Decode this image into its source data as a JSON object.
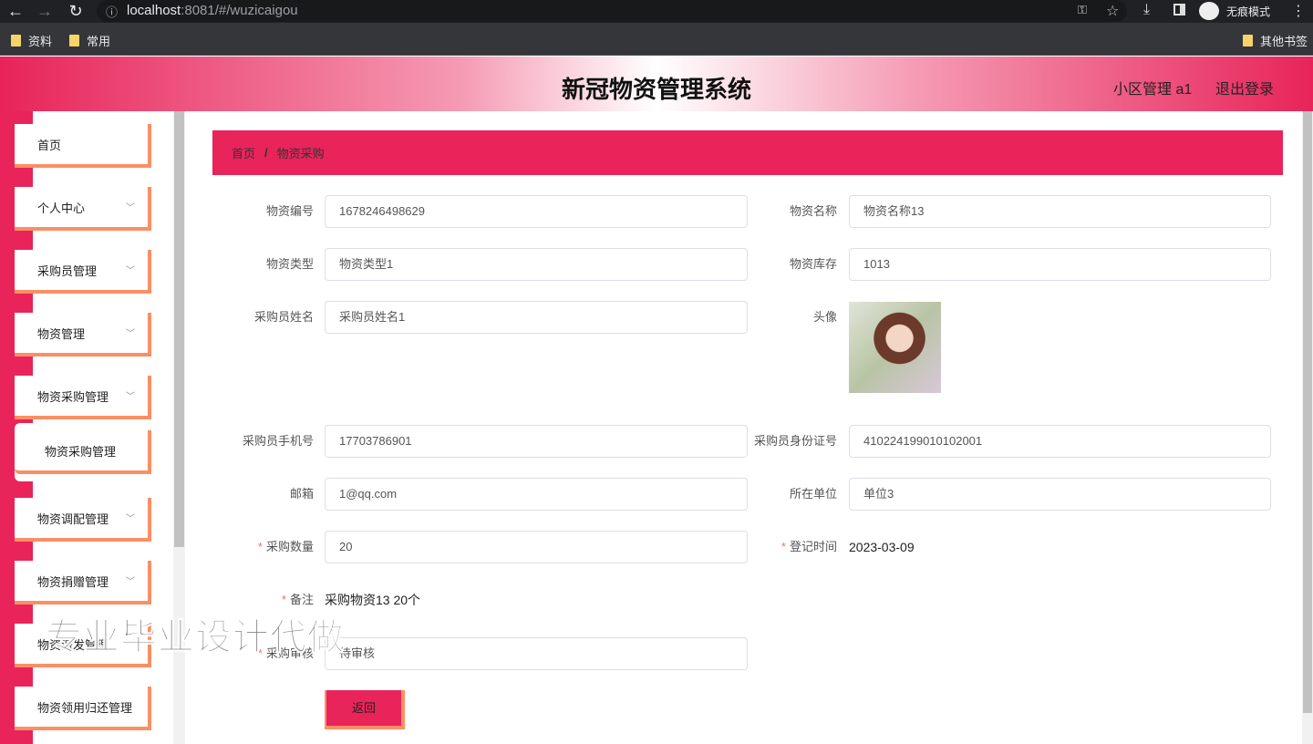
{
  "browser": {
    "url_host": "localhost",
    "url_path": ":8081/#/wuzicaigou",
    "incognito_label": "无痕模式",
    "bookmarks": [
      "资料",
      "常用"
    ],
    "other_bookmarks": "其他书签"
  },
  "header": {
    "title": "新冠物资管理系统",
    "user": "小区管理 a1",
    "logout": "退出登录"
  },
  "sidebar": {
    "items": [
      {
        "label": "首页"
      },
      {
        "label": "个人中心"
      },
      {
        "label": "采购员管理"
      },
      {
        "label": "物资管理"
      },
      {
        "label": "物资采购管理"
      },
      {
        "label": "物资采购管理"
      },
      {
        "label": "物资调配管理"
      },
      {
        "label": "物资捐赠管理"
      },
      {
        "label": "物资派发管理"
      },
      {
        "label": "物资领用归还管理"
      }
    ]
  },
  "breadcrumb": {
    "home": "首页",
    "sep": "/",
    "current": "物资采购"
  },
  "form": {
    "code_label": "物资编号",
    "code": "1678246498629",
    "name_label": "物资名称",
    "name": "物资名称13",
    "type_label": "物资类型",
    "type": "物资类型1",
    "stock_label": "物资库存",
    "stock": "1013",
    "buyer_label": "采购员姓名",
    "buyer": "采购员姓名1",
    "avatar_label": "头像",
    "phone_label": "采购员手机号",
    "phone": "17703786901",
    "idcard_label": "采购员身份证号",
    "idcard": "410224199010102001",
    "email_label": "邮箱",
    "email": "1@qq.com",
    "unit_label": "所在单位",
    "unit": "单位3",
    "qty_label": "采购数量",
    "qty": "20",
    "date_label": "登记时间",
    "date": "2023-03-09",
    "note_label": "备注",
    "note": "采购物资13 20个",
    "review_label": "采购审核",
    "review": "待审核",
    "required_mark": "*",
    "back_label": "返回"
  },
  "watermark": "专业毕业设计代做"
}
